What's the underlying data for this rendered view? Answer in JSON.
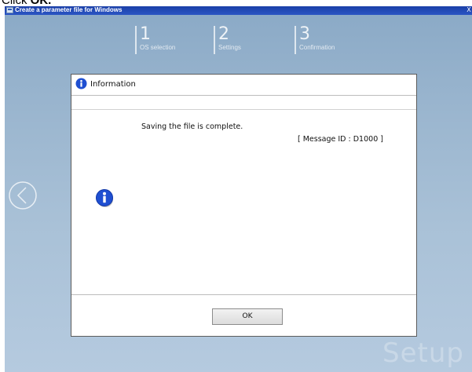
{
  "instruction": {
    "prefix": "Click ",
    "target": "OK."
  },
  "window": {
    "title": "Create a parameter file for Windows",
    "close_glyph": "X",
    "icon": "app-window-icon"
  },
  "steps": [
    {
      "number": "1",
      "label": "OS selection"
    },
    {
      "number": "2",
      "label": "Settings"
    },
    {
      "number": "3",
      "label": "Confirmation"
    }
  ],
  "watermark": "Setup",
  "dialog": {
    "title": "Information",
    "message": "Saving the file is complete.",
    "message_id": "[ Message ID : D1000 ]",
    "ok_label": "OK",
    "icon": "info-icon"
  },
  "colors": {
    "accent": "#1f4fd1",
    "titlebar": "#2148b5",
    "background": "#9bb6cf"
  }
}
